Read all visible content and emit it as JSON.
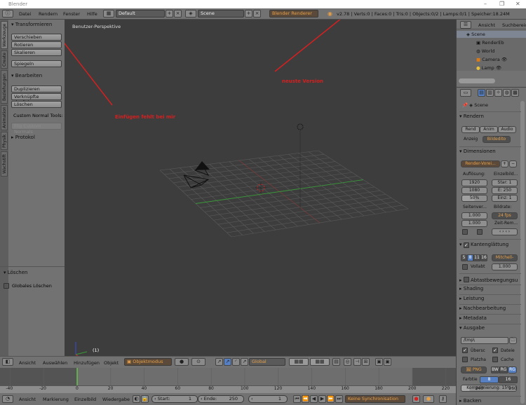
{
  "window": {
    "title": "Blender",
    "controls": [
      "–",
      "❐",
      "✕"
    ]
  },
  "topbar": {
    "menus": [
      "Datei",
      "Rendern",
      "Fenster",
      "Hilfe"
    ],
    "layout": "Default",
    "scene": "Scene",
    "engine": "Blender Renderer",
    "stats": "v2.78 | Verts:0 | Faces:0 | Tris:0 | Objects:0/2 | Lamps:0/1 | Speicher:18.24M"
  },
  "left_tabs": [
    "Werkzeuge",
    "Create",
    "Beziehungen",
    "Animation",
    "Physik",
    "Wachstift"
  ],
  "tools": {
    "transform_header": "Transformieren",
    "transform_buttons": [
      "Verschieben",
      "Rotieren",
      "Skalieren"
    ],
    "mirror": "Spiegeln",
    "edit_header": "Bearbeiten",
    "edit_buttons": [
      "Duplizieren",
      "Verknüpfte duplizieren",
      "Löschen"
    ],
    "custom_normal_label": "Custom Normal Tools:",
    "flip_normals": "Flip Custom Normals",
    "history_header": "Protokol",
    "operator_header": "Löschen",
    "global_delete": "Globales Löschen"
  },
  "viewport": {
    "title": "Benutzer-Perspektive",
    "frame_label": "(1)",
    "annotations": [
      "Einfügen fehlt bei mir",
      "neuste Version"
    ],
    "annotation_color": "#d42020"
  },
  "outliner": {
    "view": "Ansicht",
    "search": "Suchbereich",
    "items": [
      "Scene",
      "RenderEb",
      "World",
      "Camera",
      "Lamp"
    ]
  },
  "properties": {
    "context": "Scene",
    "render_header": "Rendern",
    "render_buttons": [
      "Rend",
      "Anim",
      "Audio"
    ],
    "display_label": "Anzeig",
    "display_value": "Bildedito",
    "dimensions_header": "Dimensionen",
    "render_preset": "Render-Vorei...",
    "resolution_label": "Auflösung:",
    "res_x": "1920",
    "res_y": "1080",
    "res_pct": "50%",
    "frames_label": "Einzelbild...",
    "start": "Star: 1",
    "end": "E: 250",
    "step": "Einz: 1",
    "aspect_label": "Seitenver...",
    "aspect_x": "1.000",
    "aspect_y": "1.000",
    "framerate_label": "Bildrate:",
    "framerate": "24 fps",
    "time_remap": "Zeit-Rem...",
    "aa_header": "Kantenglättung",
    "aa_samples": [
      "5",
      "8",
      "11",
      "16"
    ],
    "aa_filter": "Mitchell-",
    "full_sample": "Vollabt",
    "filter_size": "1.000",
    "collapsed": [
      "Abtastbewegungsu",
      "Shading",
      "Leistung",
      "Nachbearbeitung",
      "Metadata"
    ],
    "output_header": "Ausgabe",
    "output_path": "/tmp\\",
    "overwrite": "Übersc",
    "file_ext": "Dateie",
    "placeholders": "Platzha",
    "cache": "Cache",
    "format": "PNG",
    "color_modes": [
      "BW",
      "RG",
      "RG"
    ],
    "color_depth_label": "Farbtie",
    "color_depth": [
      "8",
      "16"
    ],
    "compression": "Komprimierung: 15%",
    "compression_pct": 15,
    "bake_header": "Backen"
  },
  "view3d_header": {
    "menus": [
      "Ansicht",
      "Auswählen",
      "Hinzufügen",
      "Objekt"
    ],
    "mode": "Objektmodus",
    "orientation": "Global"
  },
  "timeline": {
    "ticks": [
      "-40",
      "-20",
      "0",
      "20",
      "40",
      "60",
      "80",
      "100",
      "120",
      "140",
      "160",
      "180",
      "200",
      "220",
      "240",
      "260",
      "280"
    ],
    "current_frame": 1
  },
  "timeline_header": {
    "menus": [
      "Ansicht",
      "Markierung",
      "Einzelbild",
      "Wiedergabe"
    ],
    "start": "Start:",
    "start_val": "1",
    "end": "Ende:",
    "end_val": "250",
    "frame": "1",
    "sync": "Keine Synchronisation"
  }
}
